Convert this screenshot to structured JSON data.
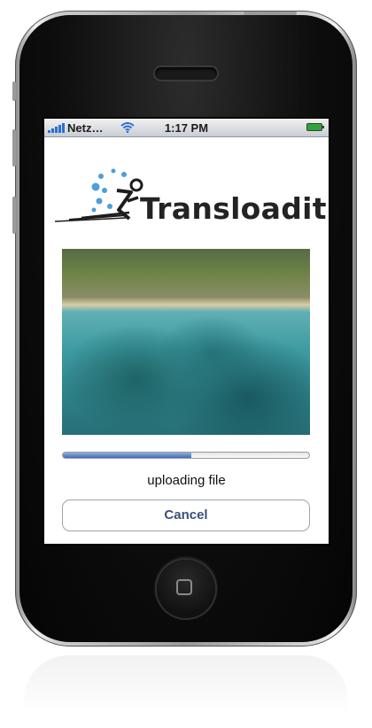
{
  "status_bar": {
    "carrier": "Netz…",
    "time": "1:17 PM",
    "battery_color": "#2ea43a"
  },
  "app": {
    "logo_text": "Transloadit",
    "logo_mark_color": "#4a9fdc",
    "progress": {
      "fraction": 0.52,
      "color": "#3c6db3"
    },
    "status_text": "uploading file",
    "cancel_label": "Cancel"
  },
  "icons": [
    "signal-bars-icon",
    "wifi-icon",
    "battery-icon",
    "home-button-icon"
  ]
}
